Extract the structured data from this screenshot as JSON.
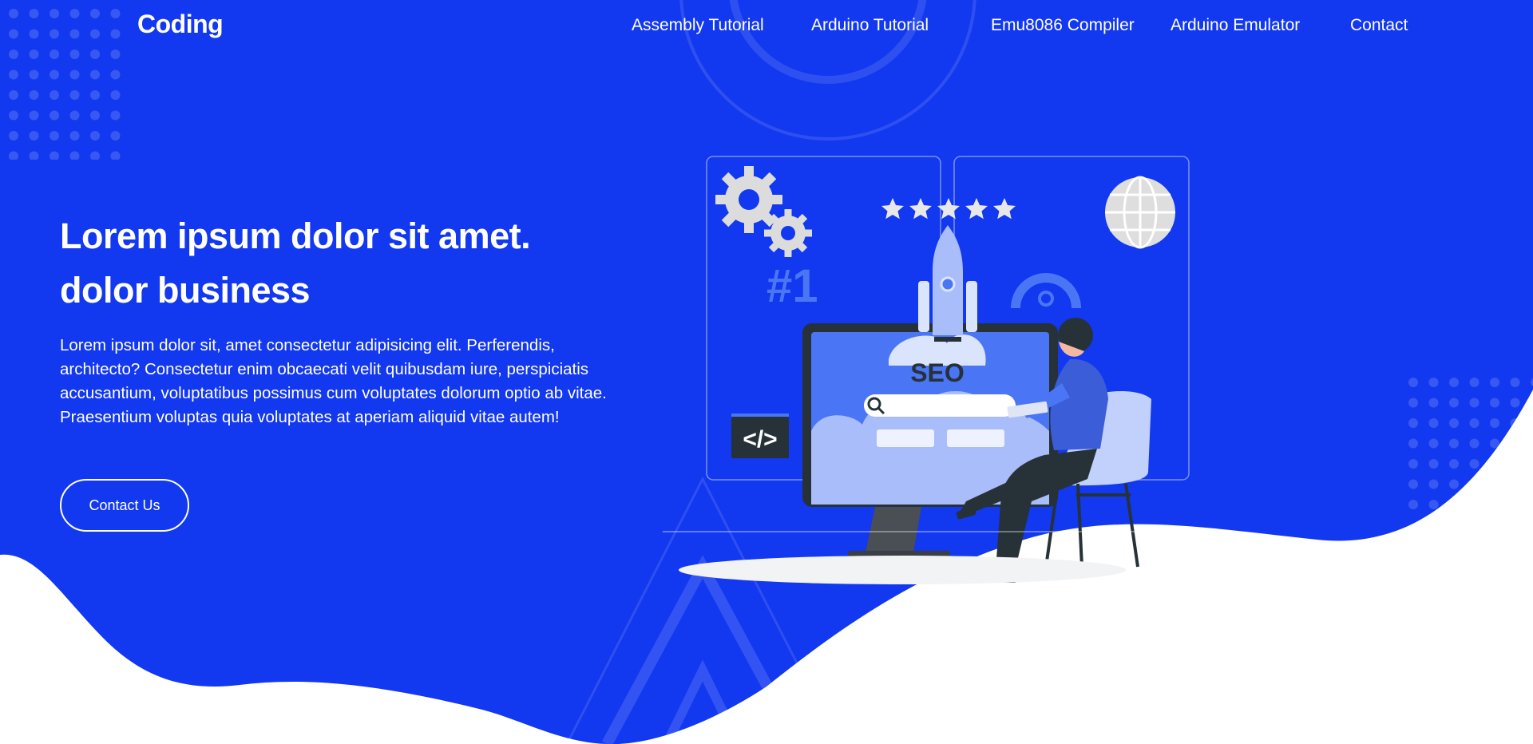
{
  "brand": {
    "name": "Coding"
  },
  "nav": {
    "items": [
      {
        "label": "Assembly Tutorial"
      },
      {
        "label": "Arduino Tutorial"
      },
      {
        "label": "Emu8086 Compiler"
      },
      {
        "label": "Arduino Emulator"
      },
      {
        "label": "Contact"
      }
    ]
  },
  "hero": {
    "title_line1": "Lorem ipsum dolor sit amet.",
    "title_line2": "dolor business",
    "text": "Lorem ipsum dolor sit, amet consectetur adipisicing elit. Perferendis, architecto? Consectetur enim obcaecati velit quibusdam iure, perspiciatis accusantium, voluptatibus possimus cum voluptates dolorum optio ab vitae. Praesentium voluptas quia voluptates at aperiam aliquid vitae autem!",
    "button_label": "Contact Us"
  },
  "illustration": {
    "seo_label": "SEO",
    "rank_label": "#1",
    "code_label": "</>",
    "rating_stars": 5
  },
  "colors": {
    "primary": "#1238f0",
    "white": "#ffffff",
    "pale_blue": "#a9bdfb",
    "mid_blue": "#4a76f6",
    "dark": "#263238"
  },
  "icons": [
    "gear-icon",
    "star-icon",
    "globe-icon",
    "rocket-icon",
    "search-icon",
    "gauge-icon",
    "code-icon"
  ]
}
